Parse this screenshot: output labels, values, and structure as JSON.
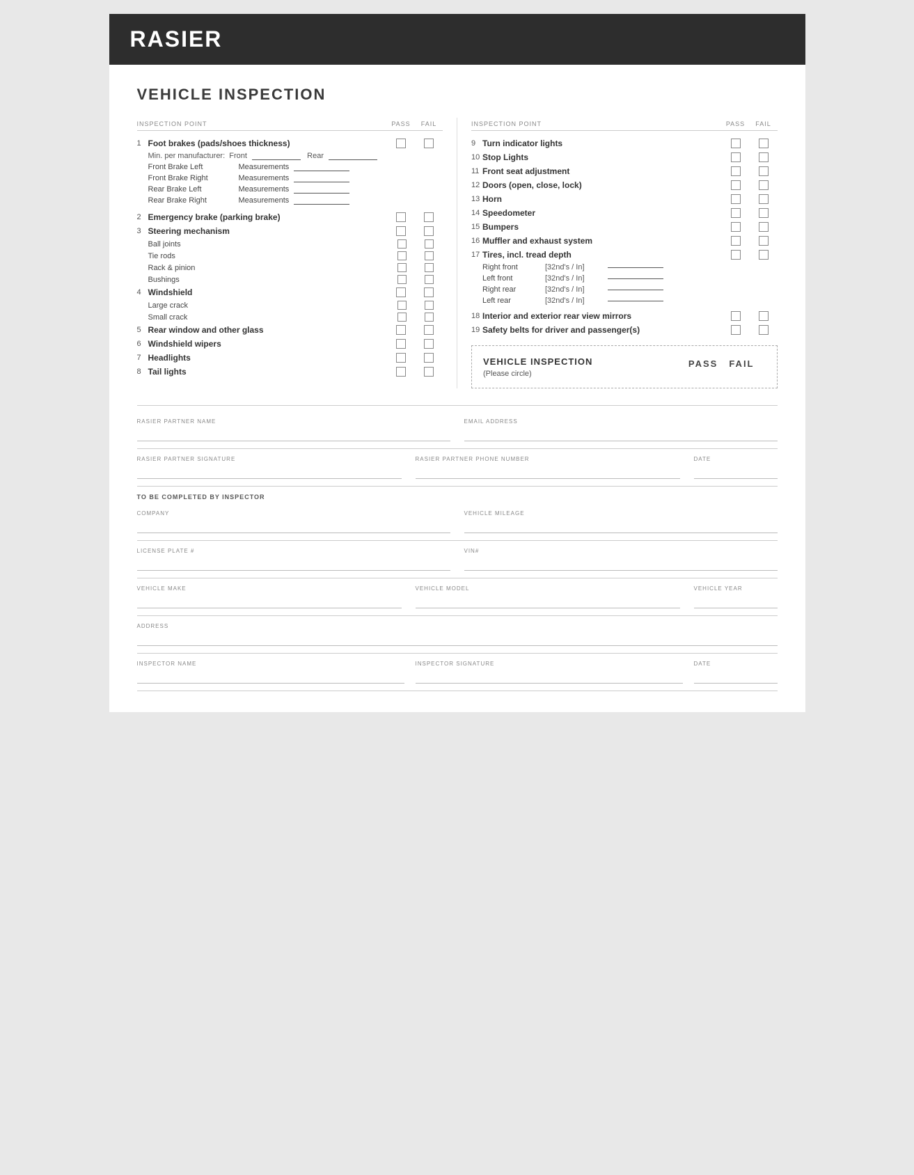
{
  "header": {
    "title": "RASIER"
  },
  "page_title": "VEHICLE INSPECTION",
  "left_section_header": {
    "inspection_point": "INSPECTION POINT",
    "pass": "PASS",
    "fail": "FAIL"
  },
  "right_section_header": {
    "inspection_point": "INSPECTION POINT",
    "pass": "PASS",
    "fail": "FAIL"
  },
  "left_items": [
    {
      "num": "1",
      "label": "Foot brakes (pads/shoes thickness)",
      "bold": true
    },
    {
      "type": "min_per",
      "text": "Min. per manufacturer:",
      "front_label": "Front",
      "rear_label": "Rear"
    },
    {
      "type": "measurement",
      "label": "Front Brake Left",
      "meas": "Measurements"
    },
    {
      "type": "measurement",
      "label": "Front Brake Right",
      "meas": "Measurements"
    },
    {
      "type": "measurement",
      "label": "Rear Brake Left",
      "meas": "Measurements"
    },
    {
      "type": "measurement",
      "label": "Rear Brake Right",
      "meas": "Measurements"
    },
    {
      "num": "2",
      "label": "Emergency brake (parking brake)",
      "bold": true
    },
    {
      "num": "3",
      "label": "Steering mechanism",
      "bold": true
    },
    {
      "type": "sub",
      "label": "Ball joints"
    },
    {
      "type": "sub",
      "label": "Tie rods"
    },
    {
      "type": "sub",
      "label": "Rack & pinion"
    },
    {
      "type": "sub",
      "label": "Bushings"
    },
    {
      "num": "4",
      "label": "Windshield",
      "bold": true
    },
    {
      "type": "sub",
      "label": "Large crack"
    },
    {
      "type": "sub",
      "label": "Small crack"
    },
    {
      "num": "5",
      "label": "Rear window and other glass",
      "bold": true
    },
    {
      "num": "6",
      "label": "Windshield wipers",
      "bold": true
    },
    {
      "num": "7",
      "label": "Headlights",
      "bold": true
    },
    {
      "num": "8",
      "label": "Tail lights",
      "bold": true
    }
  ],
  "right_items": [
    {
      "num": "9",
      "label": "Turn indicator lights",
      "bold": true
    },
    {
      "num": "10",
      "label": "Stop Lights",
      "bold": true
    },
    {
      "num": "11",
      "label": "Front seat adjustment",
      "bold": true
    },
    {
      "num": "12",
      "label": "Doors (open, close, lock)",
      "bold": true
    },
    {
      "num": "13",
      "label": "Horn",
      "bold": true
    },
    {
      "num": "14",
      "label": "Speedometer",
      "bold": true
    },
    {
      "num": "15",
      "label": "Bumpers",
      "bold": true
    },
    {
      "num": "16",
      "label": "Muffler and exhaust system",
      "bold": true
    },
    {
      "num": "17",
      "label": "Tires, incl. tread depth",
      "bold": true
    },
    {
      "type": "tread",
      "label": "Right front",
      "unit": "[32nd's / In]"
    },
    {
      "type": "tread",
      "label": "Left front",
      "unit": "[32nd's / In]"
    },
    {
      "type": "tread",
      "label": "Right rear",
      "unit": "[32nd's / In]"
    },
    {
      "type": "tread",
      "label": "Left rear",
      "unit": "[32nd's / In]"
    },
    {
      "num": "18",
      "label": "Interior and exterior rear view mirrors",
      "bold": true
    },
    {
      "num": "19",
      "label": "Safety belts for driver and passenger(s)",
      "bold": true
    }
  ],
  "dashed_box": {
    "title": "VEHICLE INSPECTION",
    "subtitle": "(Please circle)",
    "pass_label": "PASS",
    "fail_label": "FAIL"
  },
  "footer": {
    "to_be_completed": "TO BE COMPLETED BY INSPECTOR",
    "fields": {
      "rasier_partner_name": "RASIER PARTNER NAME",
      "email_address": "EMAIL ADDRESS",
      "rasier_partner_signature": "RASIER PARTNER SIGNATURE",
      "rasier_partner_phone": "RASIER PARTNER PHONE NUMBER",
      "date1": "DATE",
      "company": "COMPANY",
      "vehicle_mileage": "VEHICLE MILEAGE",
      "license_plate": "LICENSE PLATE #",
      "vin": "VIN#",
      "vehicle_make": "VEHICLE MAKE",
      "vehicle_model": "VEHICLE MODEL",
      "vehicle_year": "VEHICLE YEAR",
      "address": "ADDRESS",
      "inspector_name": "INSPECTOR NAME",
      "inspector_signature": "INSPECTOR SIGNATURE",
      "date2": "DATE"
    }
  }
}
